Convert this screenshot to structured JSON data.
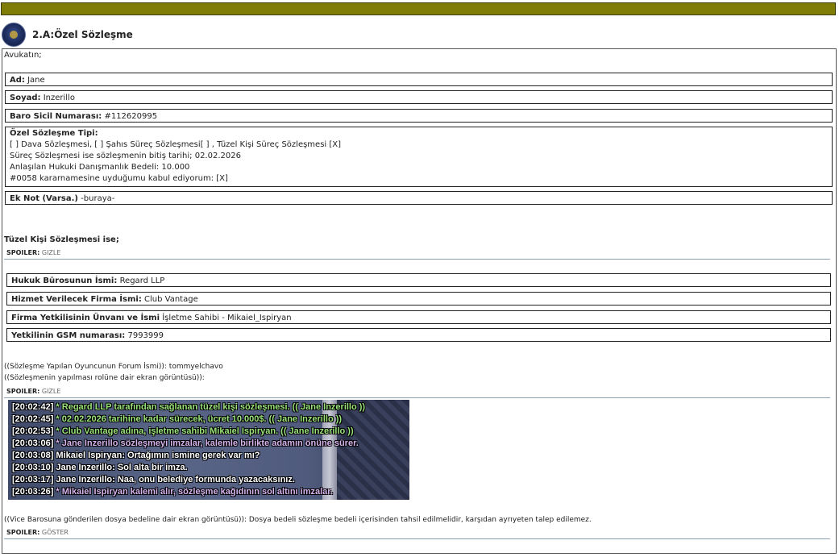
{
  "header": {
    "title": "2.A:Özel Sözleşme"
  },
  "post": {
    "intro": "Avukatın;",
    "fields": [
      {
        "label": "Ad:",
        "value": "Jane"
      },
      {
        "label": "Soyad:",
        "value": "Inzerillo"
      },
      {
        "label": "Baro Sicil Numarası:",
        "value": "#112620995"
      }
    ],
    "contract_type": {
      "label": "Özel Sözleşme Tipi:",
      "lines": [
        "[ ] Dava Sözleşmesi, [ ] Şahıs Süreç Sözleşmesi[ ] , Tüzel Kişi Süreç Sözleşmesi [X]",
        "Süreç Sözleşmesi ise sözleşmenin bitiş tarihi; 02.02.2026",
        "Anlaşılan Hukuki Danışmanlık Bedeli: 10.000",
        "#0058 kararnamesine uyduğumu kabul ediyorum: [X]"
      ]
    },
    "extra_note": {
      "label": "Ek Not (Varsa.)",
      "value": "-buraya-"
    },
    "corporate_heading": "Tüzel Kişi Sözleşmesi ise;",
    "spoiler1": {
      "label": "SPOILER:",
      "action": "GIZLE"
    },
    "corporate_fields": [
      {
        "label": "Hukuk Bürosunun İsmi:",
        "value": "Regard LLP"
      },
      {
        "label": "Hizmet Verilecek Firma İsmi:",
        "value": "Club Vantage"
      },
      {
        "label": "Firma Yetkilisinin Ünvanı ve İsmi",
        "value": "İşletme Sahibi - Mikaiel_Ispiryan"
      },
      {
        "label": "Yetkilinin GSM numarası:",
        "value": "7993999"
      }
    ],
    "forum_name_line": "((Sözleşme Yapılan Oyuncunun Forum İsmi)): tommyelchavo",
    "screenshot_line": "((Sözleşmenin yapılması rolüne dair ekran görüntüsü)):",
    "spoiler2": {
      "label": "SPOILER:",
      "action": "GIZLE"
    },
    "chat_log": [
      {
        "ts": "[20:02:42]",
        "text": " * Regard LLP tarafından sağlanan tüzel kişi sözleşmesi. (( Jane Inzerillo ))",
        "color": "#9be57a"
      },
      {
        "ts": "[20:02:45]",
        "text": " * 02.02.2026 tarihine kadar sürecek, ücret 10.000$. (( Jane Inzerillo ))",
        "color": "#9be57a"
      },
      {
        "ts": "[20:02:53]",
        "text": " * Club Vantage adına, işletme sahibi Mikaiel Ispiryan.    (( Jane Inzerillo ))",
        "color": "#9be57a"
      },
      {
        "ts": "[20:03:06]",
        "text": " * Jane Inzerillo sözleşmeyi imzalar, kalemle birlikte adamın önüne sürer.",
        "color": "#d7b4ee"
      },
      {
        "ts": "[20:03:08]",
        "text": " Mikaiel Ispiryan: Ortağımın ismine gerek var mı?",
        "color": "#ffffff"
      },
      {
        "ts": "[20:03:10]",
        "text": " Jane Inzerillo: Sol alta bir imza.",
        "color": "#ffffff"
      },
      {
        "ts": "[20:03:17]",
        "text": " Jane Inzerillo: Naa, onu belediye formunda yazacaksınız.",
        "color": "#ffffff"
      },
      {
        "ts": "[20:03:26]",
        "text": " * Mikaiel Ispiryan kalemi alır, sözleşme kağıdının sol altını imzalar.",
        "color": "#d7b4ee"
      }
    ],
    "fee_line": "((Vice Barosuna gönderilen dosya bedeline dair ekran görüntüsü)): Dosya bedeli sözleşme bedeli içerisinden tahsil edilmelidir, karşıdan ayrıyeten talep edilemez.",
    "spoiler3": {
      "label": "SPOILER:",
      "action": "GÖSTER"
    }
  },
  "colors": {
    "topbar": "#7f7d06",
    "rule": "#8aa0b4"
  }
}
